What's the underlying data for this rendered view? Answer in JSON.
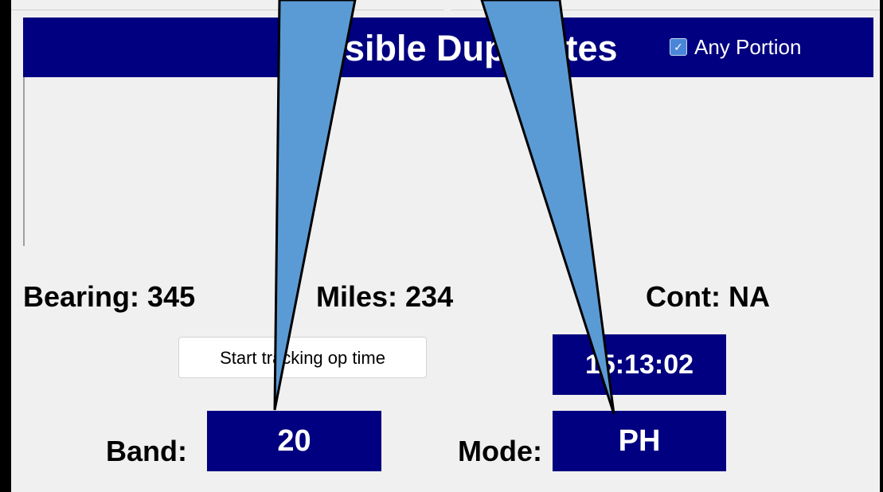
{
  "colors": {
    "background": "#000000",
    "panel": "#f0f0f0",
    "header_navy": "#000080",
    "callout_fill": "#5b9bd5",
    "checkbox_blue": "#4a86d8"
  },
  "duplicates_panel": {
    "title": "Possible Duplicates",
    "any_portion_checkbox": {
      "label": "Any Portion",
      "checked": true,
      "icon": "checkmark-icon"
    }
  },
  "info": {
    "bearing": "Bearing: 345",
    "miles": "Miles: 234",
    "cont": "Cont: NA"
  },
  "controls": {
    "start_button_label": "Start tracking op time",
    "op_time": "15:13:02",
    "band_label": "Band:",
    "band_value": "20",
    "mode_label": "Mode:",
    "mode_value": "PH"
  },
  "callouts": [
    {
      "name": "band-callout-arrow",
      "points_to": "band"
    },
    {
      "name": "mode-callout-arrow",
      "points_to": "mode"
    }
  ]
}
